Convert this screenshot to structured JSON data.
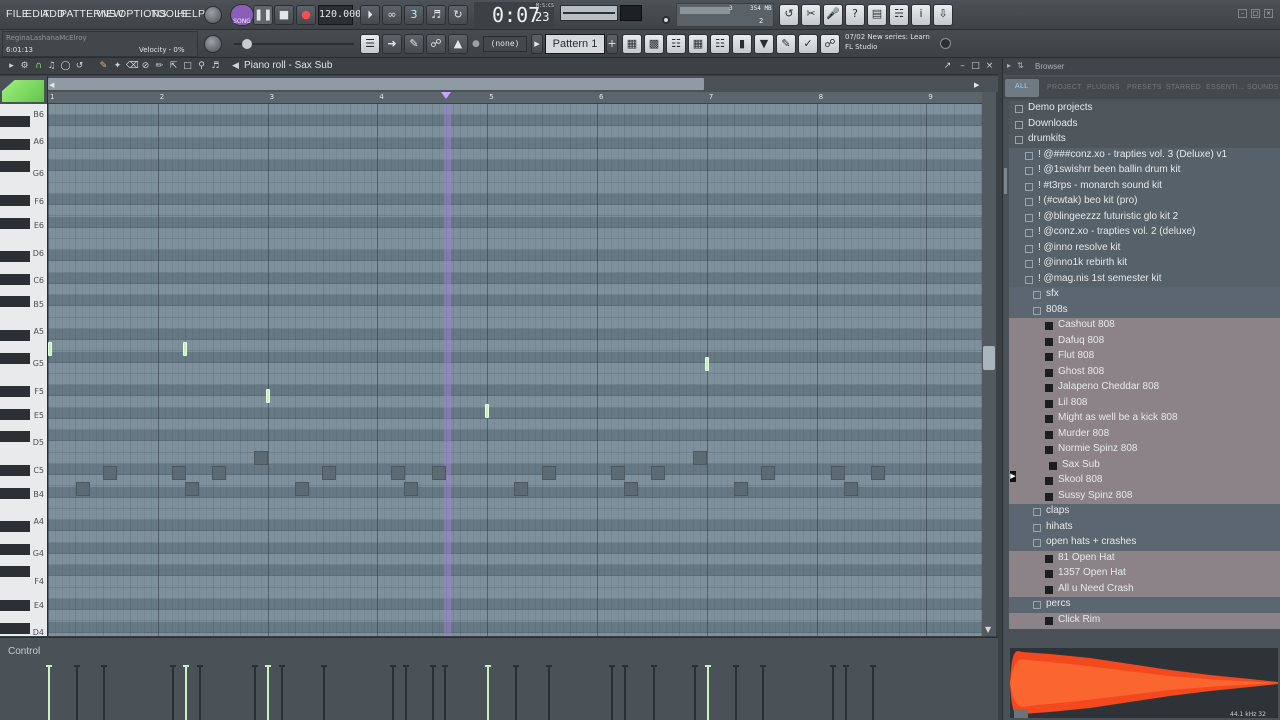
{
  "menu": [
    "FILE",
    "EDIT",
    "ADD",
    "PATTERNS",
    "VIEW",
    "OPTIONS",
    "TOOLS",
    "HELP"
  ],
  "transport": {
    "mode": "SONG",
    "tempo": "120.000",
    "time_main": "0:07",
    "time_sub": "23",
    "time_unit_label": "M:S:CS",
    "memory": "354 MB",
    "cpu_voices": "2",
    "cpu_small": "3"
  },
  "hint": {
    "user": "ReginaLashanaMcElroy",
    "position": "6:01:13",
    "velocity_label": "Velocity - 0%"
  },
  "pattern": {
    "channel": "(none)",
    "name": "Pattern 1"
  },
  "news": {
    "line1": "07/02  New series: Learn",
    "line2": "FL Studio"
  },
  "piano_roll": {
    "title": "Piano roll - Sax Sub",
    "bars": [
      "1",
      "2",
      "3",
      "4",
      "5",
      "6",
      "7",
      "8",
      "9"
    ],
    "key_labels": [
      "B6",
      "A6",
      "G6",
      "F6",
      "E6",
      "D6",
      "C6",
      "B5",
      "A5",
      "G5",
      "F5",
      "E5",
      "D5",
      "C5",
      "B4",
      "A4",
      "G4",
      "F4",
      "E4",
      "D4"
    ]
  },
  "control": {
    "label": "Control"
  },
  "browser": {
    "title": "Browser",
    "tabs": [
      "ALL",
      "PROJECT",
      "PLUGINS",
      "PRESETS",
      "STARRED",
      "ESSENTI...",
      "SOUNDS"
    ],
    "items": [
      {
        "label": "Demo projects",
        "level": 0,
        "type": "folder"
      },
      {
        "label": "Downloads",
        "level": 0,
        "type": "folder"
      },
      {
        "label": "drumkits",
        "level": 0,
        "type": "folder"
      },
      {
        "label": "! @###conz.xo - trapties vol. 3  (Deluxe) v1",
        "level": 1,
        "type": "folder"
      },
      {
        "label": "! @1swishrr been ballin drum kit",
        "level": 1,
        "type": "folder"
      },
      {
        "label": "! #t3rps - monarch sound kit",
        "level": 1,
        "type": "folder"
      },
      {
        "label": "! (#cwtak) beo kit (pro)",
        "level": 1,
        "type": "folder"
      },
      {
        "label": "! @blingeezzz futuristic glo kit 2",
        "level": 1,
        "type": "folder"
      },
      {
        "label": "! @conz.xo - trapties vol. 2 (deluxe)",
        "level": 1,
        "type": "folder"
      },
      {
        "label": "! @inno resolve kit",
        "level": 1,
        "type": "folder"
      },
      {
        "label": "! @inno1k rebirth kit",
        "level": 1,
        "type": "folder"
      },
      {
        "label": "! @mag.nis 1st semester kit",
        "level": 1,
        "type": "folder"
      },
      {
        "label": "sfx",
        "level": 2,
        "type": "folder"
      },
      {
        "label": "808s",
        "level": 2,
        "type": "folder"
      },
      {
        "label": "Cashout 808",
        "level": 3,
        "type": "file"
      },
      {
        "label": "Dafuq 808",
        "level": 3,
        "type": "file"
      },
      {
        "label": "Flut 808",
        "level": 3,
        "type": "file"
      },
      {
        "label": "Ghost 808",
        "level": 3,
        "type": "file"
      },
      {
        "label": "Jalapeno Cheddar 808",
        "level": 3,
        "type": "file"
      },
      {
        "label": "Lil 808",
        "level": 3,
        "type": "file"
      },
      {
        "label": "Might as well be a kick 808",
        "level": 3,
        "type": "file"
      },
      {
        "label": "Murder 808",
        "level": 3,
        "type": "file"
      },
      {
        "label": "Normie Spinz 808",
        "level": 3,
        "type": "file"
      },
      {
        "label": "Sax Sub",
        "level": 4,
        "type": "file",
        "selected": true
      },
      {
        "label": "Skool 808",
        "level": 3,
        "type": "file"
      },
      {
        "label": "Sussy Spinz 808",
        "level": 3,
        "type": "file"
      },
      {
        "label": "claps",
        "level": 2,
        "type": "folder"
      },
      {
        "label": "hihats",
        "level": 2,
        "type": "folder"
      },
      {
        "label": "open hats + crashes",
        "level": 2,
        "type": "folder"
      },
      {
        "label": "81 Open Hat",
        "level": 3,
        "type": "file"
      },
      {
        "label": "1357 Open Hat",
        "level": 3,
        "type": "file"
      },
      {
        "label": "All u Need Crash",
        "level": 3,
        "type": "file"
      },
      {
        "label": "percs",
        "level": 2,
        "type": "folder"
      },
      {
        "label": "Click Rim",
        "level": 3,
        "type": "file"
      }
    ],
    "waveform_info": "44.1 kHz 32"
  },
  "colors": {
    "note_green": "#bff5b4",
    "playhead": "#c7a4ff",
    "waveform": "#ff4a1c",
    "grid_bg": "#7d8f9a"
  }
}
